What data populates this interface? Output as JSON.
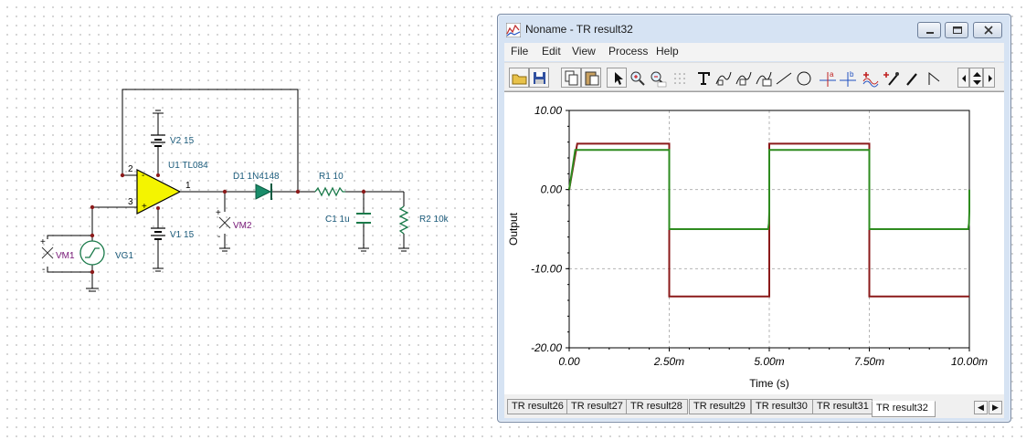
{
  "schematic": {
    "labels": {
      "v2": "V2 15",
      "u1": "U1 TL084",
      "v1": "V1 15",
      "d1": "D1 1N4148",
      "r1": "R1 10",
      "c1": "C1 1u",
      "r2": "R2 10k",
      "vm1": "VM1",
      "vg1": "VG1",
      "vm2": "VM2",
      "pin2": "2",
      "pin3": "3",
      "pin1": "1",
      "plus": "+",
      "minus": "-"
    }
  },
  "window": {
    "title": "Noname - TR result32",
    "menu": [
      "File",
      "Edit",
      "View",
      "Process",
      "Help"
    ],
    "toolbar_icons": [
      "open-folder-icon",
      "save-icon",
      "copy-icon",
      "paste-icon",
      "pointer-icon",
      "zoom-in-icon",
      "zoom-100-icon",
      "grid-icon",
      "text-icon",
      "curve-marker-icon",
      "curve-label-icon",
      "curve-table-icon",
      "line-icon",
      "circle-icon",
      "cursor-a-icon",
      "cursor-b-icon",
      "waveform-add-icon",
      "waveform-dropper-icon",
      "pen-icon",
      "angle-icon"
    ],
    "tabs": [
      "TR result26",
      "TR result27",
      "TR result28",
      "TR result29",
      "TR result30",
      "TR result31",
      "TR result32"
    ],
    "active_tab": "TR result32"
  },
  "chart_data": {
    "type": "line",
    "title": "",
    "xlabel": "Time (s)",
    "ylabel": "Output",
    "xlim": [
      0,
      0.01
    ],
    "ylim": [
      -20,
      10
    ],
    "x_ticks": [
      "0.00",
      "2.50m",
      "5.00m",
      "7.50m",
      "10.00m"
    ],
    "y_ticks": [
      "10.00",
      "0.00",
      "-10.00",
      "-20.00"
    ],
    "grid": true,
    "series": [
      {
        "color": "#8b1a1a",
        "x": [
          0,
          0.0002,
          0.0025,
          0.0025,
          0.005,
          0.005,
          0.0075,
          0.0075,
          0.01
        ],
        "y": [
          0,
          5.8,
          5.8,
          -13.5,
          -13.5,
          5.8,
          5.8,
          -13.5,
          -13.5
        ]
      },
      {
        "color": "#2e8b1f",
        "x": [
          0,
          0.00015,
          0.0025,
          0.0025,
          0.00497,
          0.00499,
          0.005,
          0.005,
          0.0075,
          0.0075,
          0.00997,
          0.00999,
          0.01,
          0.01
        ],
        "y": [
          0,
          5,
          5,
          -5,
          -5,
          -4.3,
          -2.8,
          5,
          5,
          -5,
          -5,
          -4.3,
          -2.8,
          0
        ]
      }
    ]
  }
}
